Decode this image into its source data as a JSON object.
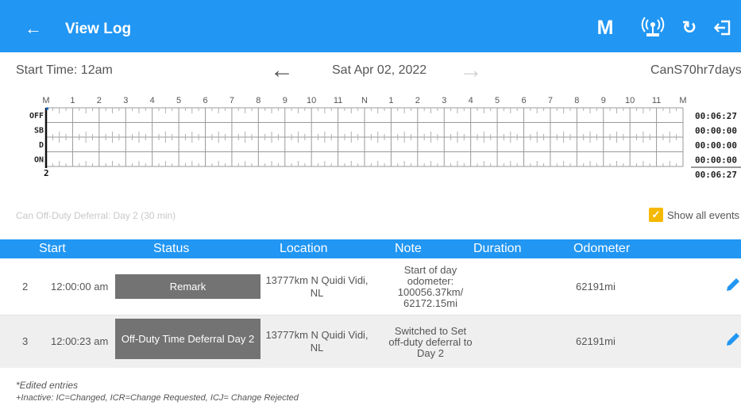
{
  "header": {
    "title": "View Log",
    "back_icon": "arrow-left-icon",
    "actions": [
      {
        "name": "m-button",
        "label": "M"
      },
      {
        "name": "wifi-broadcast-icon",
        "icon": "wifi-broadcast-icon"
      },
      {
        "name": "refresh-icon",
        "icon": "refresh-icon"
      },
      {
        "name": "logout-icon",
        "icon": "logout-icon"
      }
    ],
    "accent_color": "#2196f3"
  },
  "datebar": {
    "start_time": "Start Time: 12am",
    "date": "Sat Apr 02, 2022",
    "prev_icon": "arrow-left-icon",
    "next_icon": "arrow-right-icon",
    "cycle": "CanS70hr7days"
  },
  "graph": {
    "hour_labels": [
      "M",
      "1",
      "2",
      "3",
      "4",
      "5",
      "6",
      "7",
      "8",
      "9",
      "10",
      "11",
      "N",
      "1",
      "2",
      "3",
      "4",
      "5",
      "6",
      "7",
      "8",
      "9",
      "10",
      "11",
      "M"
    ],
    "status_rows": [
      "OFF",
      "SB",
      "D",
      "ON"
    ],
    "totals": [
      "00:06:27",
      "00:00:00",
      "00:00:00",
      "00:00:00"
    ],
    "grand_total": "00:06:27",
    "event_marker": "2"
  },
  "deferral_note": "Can Off-Duty Deferral: Day 2 (30 min)",
  "show_all_events": {
    "label": "Show all events",
    "checked": true,
    "color": "#f5b800"
  },
  "table": {
    "columns": [
      "Start",
      "Status",
      "Location",
      "Note",
      "Duration",
      "Odometer"
    ],
    "rows": [
      {
        "num": "2",
        "start": "12:00:00 am",
        "status": "Remark",
        "location": "13777km N Quidi Vidi, NL",
        "note": "Start of day odometer: 100056.37km/ 62172.15mi",
        "duration": "",
        "odometer": "62191mi"
      },
      {
        "num": "3",
        "start": "12:00:23 am",
        "status": "Off-Duty Time Deferral Day 2",
        "location": "13777km N Quidi Vidi, NL",
        "note": "Switched to Set off-duty deferral to Day 2",
        "duration": "",
        "odometer": "62191mi"
      }
    ]
  },
  "footnotes": {
    "edited": "*Edited entries",
    "inactive": "+Inactive: IC=Changed, ICR=Change Requested, ICJ= Change Rejected"
  }
}
